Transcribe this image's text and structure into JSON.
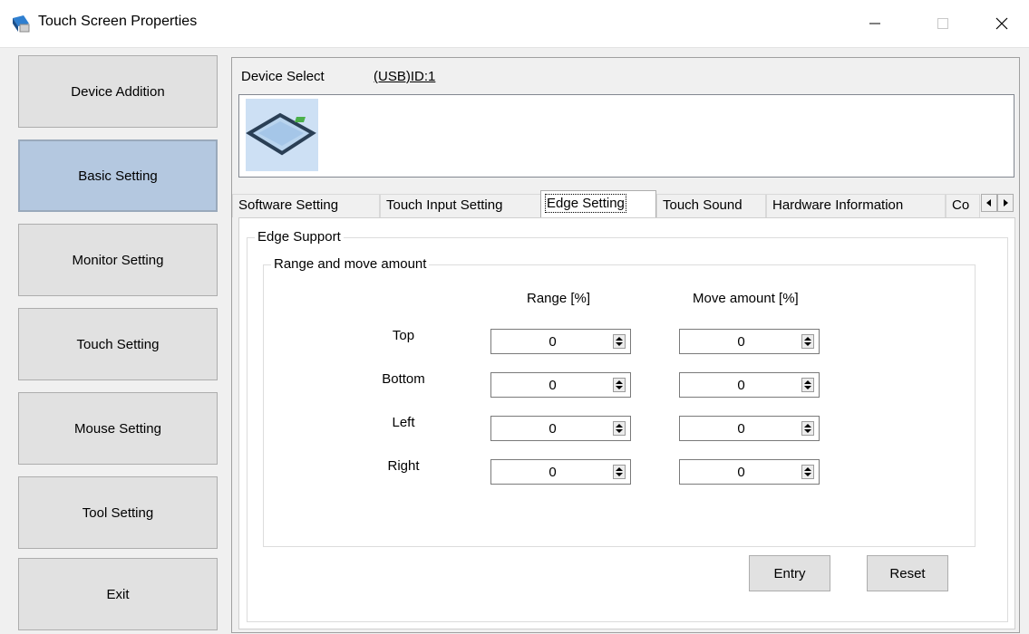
{
  "window": {
    "title": "Touch Screen Properties"
  },
  "sidebar": {
    "items": [
      {
        "label": "Device Addition"
      },
      {
        "label": "Basic Setting"
      },
      {
        "label": "Monitor Setting"
      },
      {
        "label": "Touch Setting"
      },
      {
        "label": "Mouse Setting"
      },
      {
        "label": "Tool Setting"
      },
      {
        "label": "Exit"
      }
    ],
    "active": "Basic Setting"
  },
  "device": {
    "select_label": "Device Select",
    "selected": "(USB)ID:1"
  },
  "tabs": [
    {
      "label": "Software Setting"
    },
    {
      "label": "Touch Input Setting"
    },
    {
      "label": "Edge Setting"
    },
    {
      "label": "Touch Sound"
    },
    {
      "label": "Hardware Information"
    },
    {
      "label": "Co"
    }
  ],
  "active_tab": "Edge Setting",
  "edge": {
    "group_title": "Edge Support",
    "subgroup_title": "Range and move amount",
    "col_range": "Range [%]",
    "col_move": "Move amount [%]",
    "rows": [
      {
        "label": "Top",
        "range": "0",
        "move": "0"
      },
      {
        "label": "Bottom",
        "range": "0",
        "move": "0"
      },
      {
        "label": "Left",
        "range": "0",
        "move": "0"
      },
      {
        "label": "Right",
        "range": "0",
        "move": "0"
      }
    ]
  },
  "buttons": {
    "entry": "Entry",
    "reset": "Reset"
  },
  "colors": {
    "active_sidebar": "#b4c8e0",
    "window_bg": "#f0f0f0"
  },
  "icons": [
    "app-icon",
    "minimize-icon",
    "maximize-icon",
    "close-icon",
    "touch-panel-icon",
    "spin-updown-icon",
    "scroll-left-icon",
    "scroll-right-icon"
  ]
}
